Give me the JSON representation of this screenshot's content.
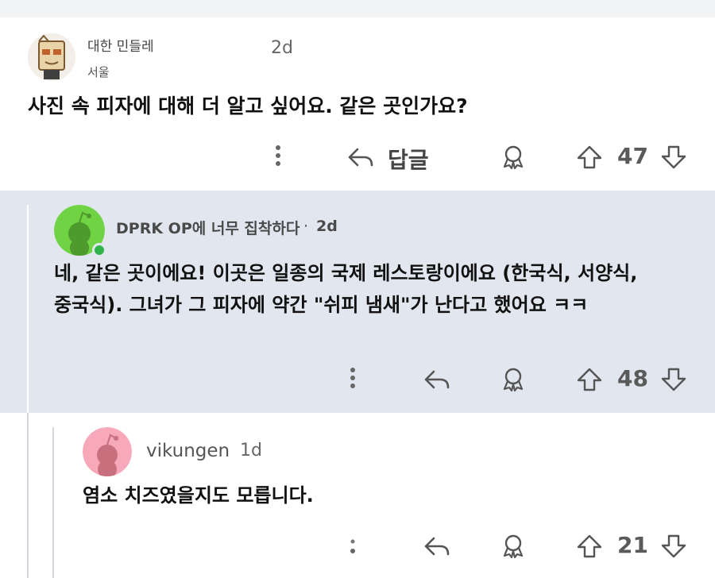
{
  "comments": [
    {
      "username": "대한 민들레",
      "flair": "서울",
      "time": "2d",
      "body": "사진 속 피자에 대해 더 알고 싶어요. 같은 곳인가요?",
      "reply_label": "답글",
      "votes": "47"
    },
    {
      "username": "DPRK OP에 너무 집착하다",
      "separator": "·",
      "time": "2d",
      "body_line1": "네, 같은 곳이에요! 이곳은 일종의 국제 레스토랑이에요 (한국식, 서양식,",
      "body_line2": "중국식). 그녀가 그 피자에 약간 \"쉬피 냄새\"가 난다고 했어요 ㅋㅋ",
      "votes": "48",
      "avatar_color": "#6fd343",
      "online_color": "#2fb34a"
    },
    {
      "username": "vikungen",
      "time": "1d",
      "body": "염소 치즈였을지도 모릅니다.",
      "votes": "21",
      "avatar_color": "#f7a9b9"
    }
  ],
  "icons": {
    "more": "more-vertical-icon",
    "reply": "reply-arrow-icon",
    "award": "award-icon",
    "upvote": "upvote-arrow-icon",
    "downvote": "downvote-arrow-icon"
  }
}
